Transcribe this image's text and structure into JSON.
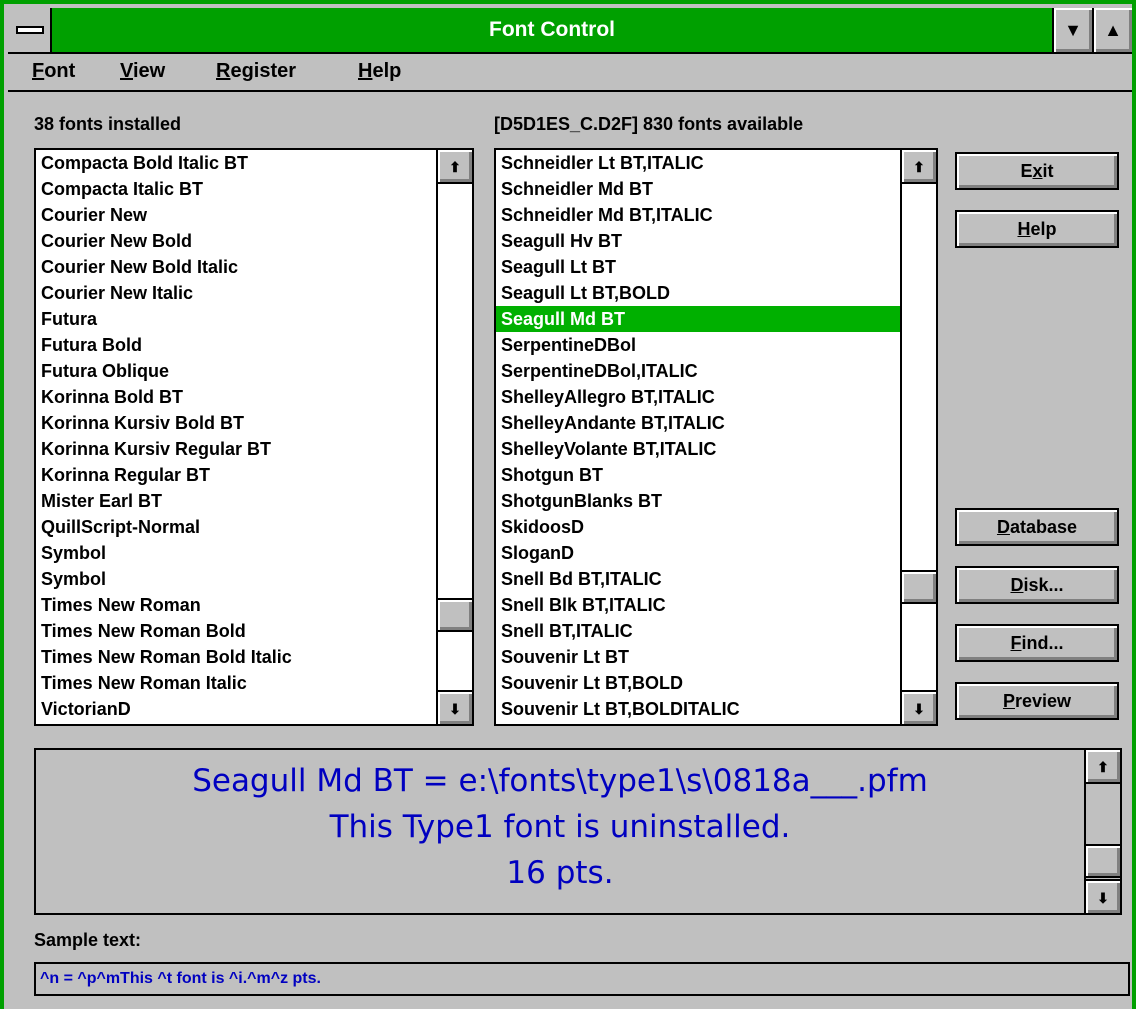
{
  "window": {
    "title": "Font Control"
  },
  "menu": [
    {
      "label": "Font",
      "accel": "F",
      "rest": "ont"
    },
    {
      "label": "View",
      "accel": "V",
      "rest": "iew"
    },
    {
      "label": "Register",
      "accel": "R",
      "rest": "egister"
    },
    {
      "label": "Help",
      "accel": "H",
      "rest": "elp"
    }
  ],
  "installed": {
    "caption": "38 fonts installed",
    "items": [
      "Compacta Bold Italic BT",
      "Compacta Italic BT",
      "Courier New",
      "Courier New Bold",
      "Courier New Bold Italic",
      "Courier New Italic",
      "Futura",
      "Futura Bold",
      "Futura Oblique",
      "Korinna Bold BT",
      "Korinna Kursiv Bold BT",
      "Korinna Kursiv Regular BT",
      "Korinna Regular BT",
      "Mister Earl BT",
      "QuillScript-Normal",
      "Symbol",
      "Symbol",
      "Times New Roman",
      "Times New Roman Bold",
      "Times New Roman Bold Italic",
      "Times New Roman Italic",
      "VictorianD"
    ]
  },
  "available": {
    "caption": "[D5D1ES_C.D2F] 830 fonts available",
    "selected_index": 6,
    "items": [
      "Schneidler Lt BT,ITALIC",
      "Schneidler Md BT",
      "Schneidler Md BT,ITALIC",
      "Seagull Hv BT",
      "Seagull Lt BT",
      "Seagull Lt BT,BOLD",
      "Seagull Md BT",
      "SerpentineDBol",
      "SerpentineDBol,ITALIC",
      "ShelleyAllegro BT,ITALIC",
      "ShelleyAndante BT,ITALIC",
      "ShelleyVolante BT,ITALIC",
      "Shotgun BT",
      "ShotgunBlanks BT",
      "SkidoosD",
      "SloganD",
      "Snell Bd BT,ITALIC",
      "Snell Blk BT,ITALIC",
      "Snell BT,ITALIC",
      "Souvenir Lt BT",
      "Souvenir Lt BT,BOLD",
      "Souvenir Lt BT,BOLDITALIC"
    ]
  },
  "buttons": {
    "exit": {
      "accel": "",
      "pre": "E",
      "u": "x",
      "post": "it"
    },
    "help": {
      "pre": "",
      "u": "H",
      "post": "elp"
    },
    "database": {
      "pre": "",
      "u": "D",
      "post": "atabase"
    },
    "disk": {
      "pre": "",
      "u": "D",
      "post": "isk..."
    },
    "find": {
      "pre": "",
      "u": "F",
      "post": "ind..."
    },
    "preview": {
      "pre": "",
      "u": "P",
      "post": "review"
    }
  },
  "preview": {
    "lines": [
      "Seagull Md BT = e:\\fonts\\type1\\s\\0818a___.pfm",
      "This Type1 font is uninstalled.",
      "16 pts."
    ]
  },
  "sample": {
    "label": "Sample text:",
    "value": "^n = ^p^mThis ^t font is ^i.^m^z pts."
  },
  "colors": {
    "titlebar": "#00a000",
    "selection": "#00b000",
    "preview_text": "#0000c0"
  },
  "icons": {
    "scroll_up": "up-arrow-icon",
    "scroll_down": "down-arrow-icon",
    "minimize": "triangle-down-icon",
    "maximize": "triangle-up-icon"
  }
}
